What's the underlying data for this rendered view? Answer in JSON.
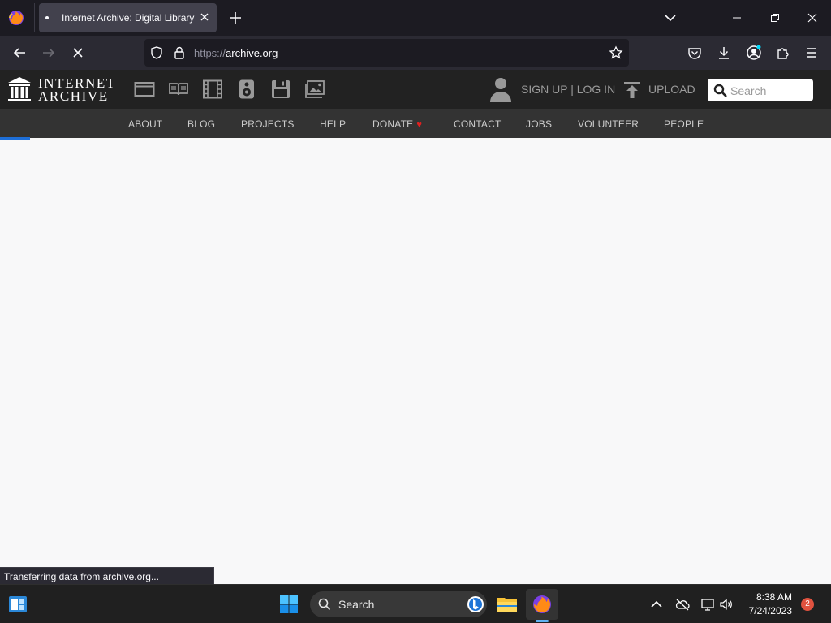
{
  "browser": {
    "tab_title": "Internet Archive: Digital Library",
    "url_scheme": "https://",
    "url_host": "archive.org",
    "status_text": "Transferring data from archive.org..."
  },
  "ia": {
    "logo_line1": "INTERNET",
    "logo_line2": "ARCHIVE",
    "media_icons": [
      "web-icon",
      "texts-icon",
      "video-icon",
      "audio-icon",
      "software-icon",
      "images-icon"
    ],
    "signup_label": "SIGN UP | LOG IN",
    "upload_label": "UPLOAD",
    "search_placeholder": "Search",
    "nav": [
      "ABOUT",
      "BLOG",
      "PROJECTS",
      "HELP",
      "DONATE",
      "CONTACT",
      "JOBS",
      "VOLUNTEER",
      "PEOPLE"
    ]
  },
  "taskbar": {
    "search_label": "Search",
    "time": "8:38 AM",
    "date": "7/24/2023",
    "notification_count": "2"
  },
  "colors": {
    "browser_tabbar": "#1c1b22",
    "browser_navbar": "#2b2a33",
    "ia_header": "#222222",
    "ia_nav": "#333333",
    "load_accent": "#1e6fd9",
    "donate_heart": "#e02020"
  }
}
